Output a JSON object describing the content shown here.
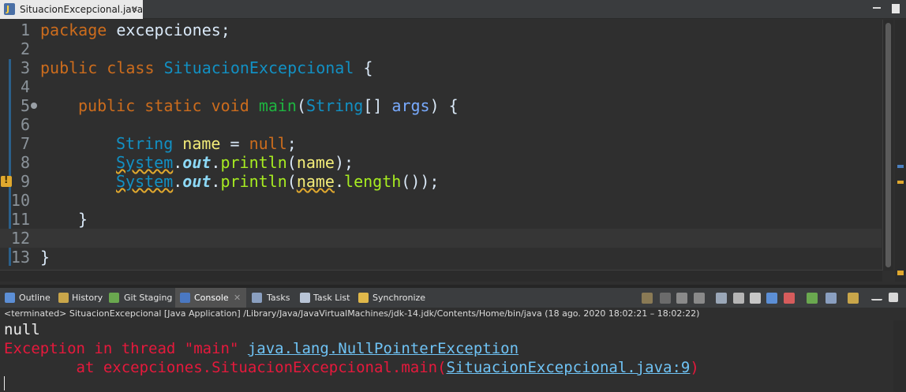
{
  "editor_tab": {
    "title": "SituacionExcepcional.java",
    "close": "✕"
  },
  "line_numbers": [
    "1",
    "2",
    "3",
    "4",
    "5",
    "6",
    "7",
    "8",
    "9",
    "10",
    "11",
    "12",
    "13"
  ],
  "code": {
    "l1": {
      "kw": "package",
      "rest": " excepciones;"
    },
    "l3": {
      "kw1": "public",
      "kw2": "class",
      "cls": "SituacionExcepcional",
      "brace": " {"
    },
    "l5": {
      "kw1": "public",
      "kw2": "static",
      "kw3": "void",
      "meth": "main",
      "open": "(",
      "type": "String",
      "arr": "[] ",
      "param": "args",
      "close": ") {"
    },
    "l7": {
      "type": "String",
      "var": "name",
      "eq": " = ",
      "nul": "null",
      "semi": ";"
    },
    "l8": {
      "sys": "System",
      "dot1": ".",
      "out": "out",
      "dot2": ".",
      "call": "println",
      "open": "(",
      "arg": "name",
      "close": ");"
    },
    "l9": {
      "sys": "System",
      "dot1": ".",
      "out": "out",
      "dot2": ".",
      "call": "println",
      "open": "(",
      "arg": "name",
      "dot3": ".",
      "len": "length",
      "close": "());"
    },
    "l11": {
      "brace": "}"
    },
    "l13": {
      "brace": "}"
    }
  },
  "views": {
    "tabs": [
      {
        "label": "Outline"
      },
      {
        "label": "History"
      },
      {
        "label": "Git Staging"
      },
      {
        "label": "Console",
        "active": true,
        "close": "✕"
      },
      {
        "label": "Tasks"
      },
      {
        "label": "Task List"
      },
      {
        "label": "Synchronize"
      }
    ]
  },
  "console": {
    "header": "<terminated> SituacionExcepcional [Java Application] /Library/Java/JavaVirtualMachines/jdk-14.jdk/Contents/Home/bin/java  (18 ago. 2020 18:02:21 – 18:02:22)",
    "out_line": "null",
    "err_prefix": "Exception in thread \"main\" ",
    "err_link": "java.lang.NullPointerException",
    "trace_prefix": "        at excepciones.SituacionExcepcional.main(",
    "trace_link": "SituacionExcepcional.java:9",
    "trace_suffix": ")"
  },
  "colors": {
    "keyword": "#cc6c1d",
    "class": "#1290c3",
    "method_decl": "#1eb540",
    "method_call": "#a7ec21",
    "local_var": "#f3ec79",
    "param": "#79abff",
    "static_field": "#8dd9f7",
    "stderr": "#e6193c",
    "link": "#6fc3f5"
  },
  "icons": [
    "java-file-icon",
    "close-icon",
    "minimize-icon",
    "maximize-icon",
    "warning-icon",
    "fold-icon",
    "outline-icon",
    "history-icon",
    "git-staging-icon",
    "console-icon",
    "tasks-icon",
    "task-list-icon",
    "synchronize-icon"
  ]
}
